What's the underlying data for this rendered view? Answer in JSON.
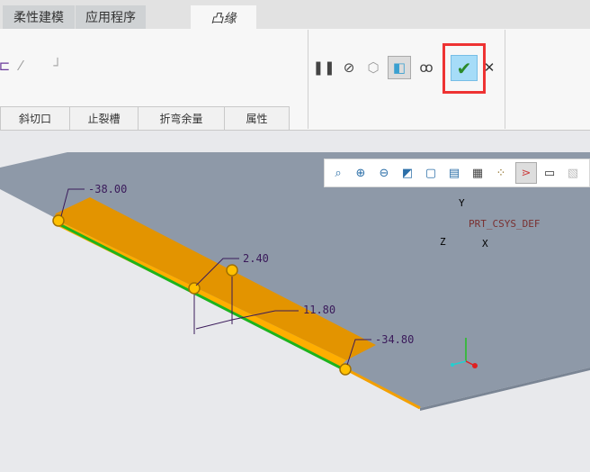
{
  "tabs": [
    {
      "label": "柔性建模"
    },
    {
      "label": "应用程序"
    },
    {
      "label": "凸缘",
      "active": true
    }
  ],
  "subtabs": [
    {
      "label": "斜切口"
    },
    {
      "label": "止裂槽"
    },
    {
      "label": "折弯余量"
    },
    {
      "label": "属性"
    }
  ],
  "actions": {
    "pause": "pause-icon",
    "no_preview": "no-preview-icon",
    "wireframe": "wireframe-preview-icon",
    "shaded": "shaded-preview-icon",
    "verify": "glasses-icon",
    "ok": "checkmark-icon",
    "cancel": "close-icon"
  },
  "view_toolbar": [
    "refit-icon",
    "zoom-in-icon",
    "zoom-out-icon",
    "repaint-icon",
    "saved-orientations-icon",
    "display-style-icon",
    "snapshot-icon",
    "datum-display-icon",
    "annotation-display-icon",
    "view-manager-icon",
    "spin-center-icon"
  ],
  "dimensions": {
    "d1": "-38.00",
    "d2": "2.40",
    "d3": "11.80",
    "d4": "-34.80"
  },
  "csys": {
    "name": "PRT_CSYS_DEF",
    "x": "X",
    "y": "Y",
    "z": "Z"
  },
  "colors": {
    "flange": "#e39400",
    "highlight": "#ffb000",
    "edge": "#1db31d",
    "plate": "#8e99a8",
    "ok_border": "#e53935"
  }
}
